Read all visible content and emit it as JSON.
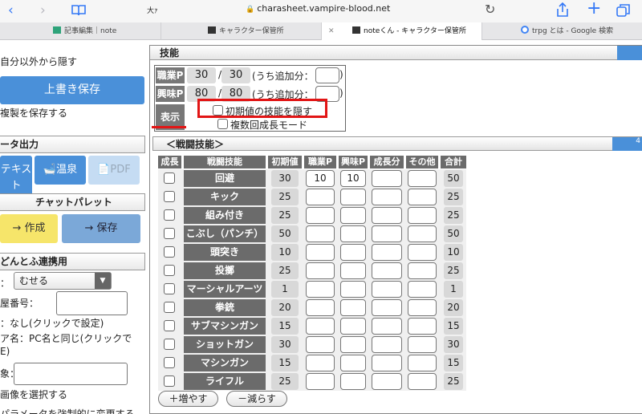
{
  "browser": {
    "text_size": "大ｧ",
    "url": "charasheet.vampire-blood.net",
    "tabs": [
      {
        "label": "記事編集｜note",
        "active": false
      },
      {
        "label": "キャラクター保管所",
        "active": false
      },
      {
        "label": "noteくん - キャラクター保管所",
        "active": true
      },
      {
        "label": "trpg とは - Google 検索",
        "active": false
      }
    ]
  },
  "left": {
    "hide_others": "自分以外から隠す",
    "overwrite_save": "上書き保存",
    "save_copy": "複製を保存する",
    "data_output_title": "ータ出力",
    "text_tile": "テキスト",
    "onsen_tile": "温泉",
    "pdf_tile": "PDF",
    "chat_palette_title": "チャットパレット",
    "create_btn": "→ 作成",
    "save_btn": "→ 保存",
    "dodontofu_title": "どんとふ連携用",
    "select_value": "むせる",
    "room_number_label": "屋番号：",
    "room_none": "：なし(クリックで設定)",
    "name_line1": "ア名：PC名と同じ(クリックで",
    "name_line2": "E)",
    "image_label": "象：",
    "choose_image": "画像を選択する",
    "bottom_cut": "パラメータを強制的に変更する"
  },
  "skills": {
    "title": "技能",
    "job_label": "職業P",
    "hobby_label": "興味P",
    "job_points": "30",
    "job_max": "30",
    "hobby_points": "80",
    "hobby_max": "80",
    "slash": "/",
    "extra_label": "(うち追加分：",
    "extra_close": ")",
    "display_label": "表示",
    "hide_initial": "初期値の技能を隠す",
    "multi_growth": "複数回成長モード"
  },
  "battle": {
    "title": "＜戦闘技能＞",
    "headers": [
      "成長",
      "戦闘技能",
      "初期値",
      "職業P",
      "興味P",
      "成長分",
      "その他",
      "合計"
    ],
    "rows": [
      {
        "name": "回避",
        "initial": "30",
        "job": "10",
        "hobby": "10",
        "total": "50"
      },
      {
        "name": "キック",
        "initial": "25",
        "job": "",
        "hobby": "",
        "total": "25"
      },
      {
        "name": "組み付き",
        "initial": "25",
        "job": "",
        "hobby": "",
        "total": "25"
      },
      {
        "name": "こぶし（パンチ）",
        "initial": "50",
        "job": "",
        "hobby": "",
        "total": "50"
      },
      {
        "name": "頭突き",
        "initial": "10",
        "job": "",
        "hobby": "",
        "total": "10"
      },
      {
        "name": "投擲",
        "initial": "25",
        "job": "",
        "hobby": "",
        "total": "25"
      },
      {
        "name": "マーシャルアーツ",
        "initial": "1",
        "job": "",
        "hobby": "",
        "total": "1"
      },
      {
        "name": "拳銃",
        "initial": "20",
        "job": "",
        "hobby": "",
        "total": "20"
      },
      {
        "name": "サブマシンガン",
        "initial": "15",
        "job": "",
        "hobby": "",
        "total": "15"
      },
      {
        "name": "ショットガン",
        "initial": "30",
        "job": "",
        "hobby": "",
        "total": "30"
      },
      {
        "name": "マシンガン",
        "initial": "15",
        "job": "",
        "hobby": "",
        "total": "15"
      },
      {
        "name": "ライフル",
        "initial": "25",
        "job": "",
        "hobby": "",
        "total": "25"
      }
    ],
    "add_btn": "＋増やす",
    "remove_btn": "－減らす",
    "corner_mark": "4"
  },
  "colors": {
    "accent_blue": "#4a90d9",
    "highlight_red": "#e21515",
    "dark_label": "#6b6b6b"
  }
}
